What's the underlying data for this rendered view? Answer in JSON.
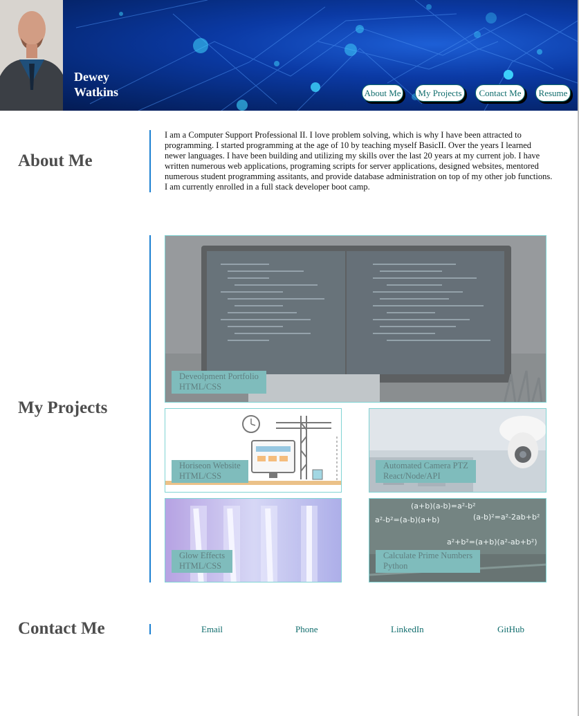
{
  "header": {
    "first_name": "Dewey",
    "last_name": "Watkins",
    "nav": [
      "About Me",
      "My Projects",
      "Contact Me",
      "Resume"
    ]
  },
  "about": {
    "title": "About Me",
    "text": "I am a Computer Support Professional II. I love problem solving, which is why I have been attracted to programming. I started programming at the age of 10 by teaching myself BasicII. Over the years I learned newer languages. I have been building and utilizing my skills over the last 20 years at my current job. I have written numerous web applications, programing scripts for server applications, designed websites, mentored numerous student programming assitants, and provide database administration on top of my other job functions. I am currently enrolled in a full stack developer boot camp."
  },
  "projects": {
    "title": "My Projects",
    "items": [
      {
        "name": "Deveolpment Portfolio",
        "tech": "HTML/CSS"
      },
      {
        "name": "Horiseon Website",
        "tech": "HTML/CSS"
      },
      {
        "name": "Automated Camera PTZ",
        "tech": "React/Node/API"
      },
      {
        "name": "Glow Effects",
        "tech": "HTML/CSS"
      },
      {
        "name": "Calculate Prime Numbers",
        "tech": "Python"
      }
    ]
  },
  "contact": {
    "title": "Contact Me",
    "links": [
      "Email",
      "Phone",
      "LinkedIn",
      "GitHub"
    ]
  },
  "colors": {
    "accent_line": "#1a7fd1",
    "label_bg": "#7fbcbc",
    "link": "#0f6c6c",
    "heading": "#4d4d4d"
  }
}
